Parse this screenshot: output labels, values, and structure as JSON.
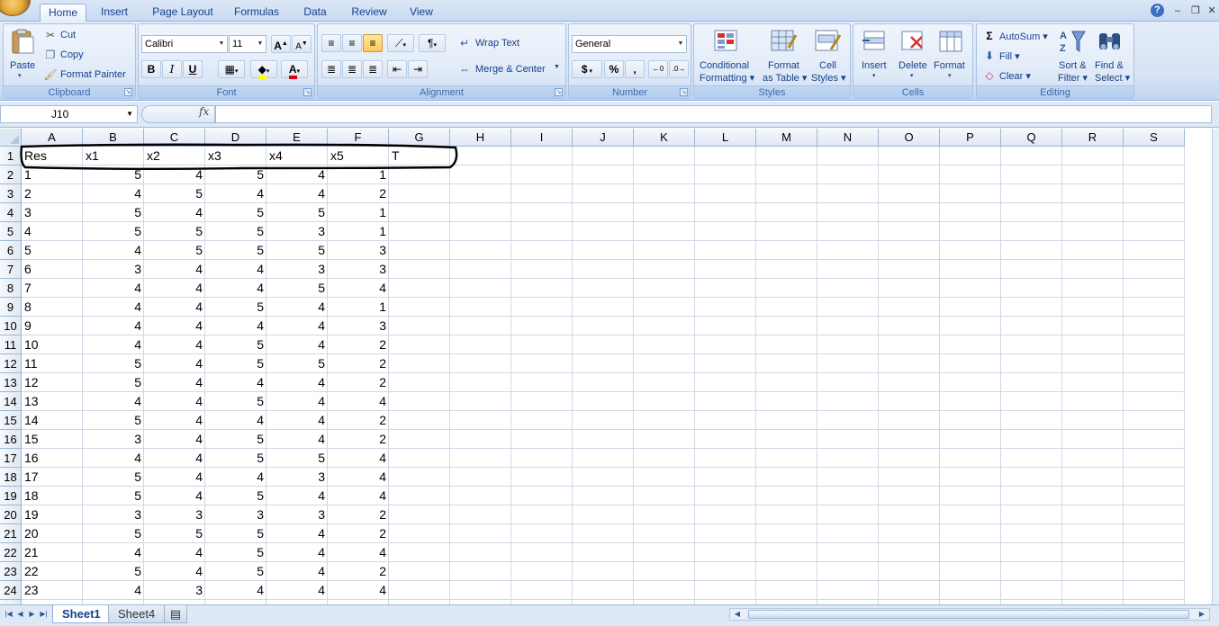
{
  "ribbon_tabs": [
    "Home",
    "Insert",
    "Page Layout",
    "Formulas",
    "Data",
    "Review",
    "View"
  ],
  "active_tab": "Home",
  "clipboard": {
    "paste": "Paste",
    "cut": "Cut",
    "copy": "Copy",
    "format_painter": "Format Painter",
    "label": "Clipboard"
  },
  "font": {
    "name": "Calibri",
    "size": "11",
    "bold": "B",
    "italic": "I",
    "underline": "U",
    "label": "Font"
  },
  "alignment": {
    "wrap_text": "Wrap Text",
    "merge_center": "Merge & Center",
    "label": "Alignment"
  },
  "number": {
    "format": "General",
    "currency": "$",
    "percent": "%",
    "comma": ",",
    "label": "Number"
  },
  "styles": {
    "conditional_1": "Conditional",
    "conditional_2": "Formatting",
    "format_table_1": "Format",
    "format_table_2": "as Table",
    "cell_styles_1": "Cell",
    "cell_styles_2": "Styles",
    "label": "Styles"
  },
  "cells": {
    "insert": "Insert",
    "delete": "Delete",
    "format": "Format",
    "label": "Cells"
  },
  "editing": {
    "autosum": "AutoSum",
    "fill": "Fill",
    "clear": "Clear",
    "sort_1": "Sort &",
    "sort_2": "Filter",
    "find_1": "Find &",
    "find_2": "Select",
    "label": "Editing"
  },
  "formula_bar": {
    "name_box": "J10",
    "fx": "fx",
    "content": ""
  },
  "columns": [
    "A",
    "B",
    "C",
    "D",
    "E",
    "F",
    "G",
    "H",
    "I",
    "J",
    "K",
    "L",
    "M",
    "N",
    "O",
    "P",
    "Q",
    "R",
    "S"
  ],
  "header_row": [
    "Res",
    "x1",
    "x2",
    "x3",
    "x4",
    "x5",
    "T"
  ],
  "rows": [
    [
      "1",
      "5",
      "4",
      "5",
      "4",
      "1"
    ],
    [
      "2",
      "4",
      "5",
      "4",
      "4",
      "2"
    ],
    [
      "3",
      "5",
      "4",
      "5",
      "5",
      "1"
    ],
    [
      "4",
      "5",
      "5",
      "5",
      "3",
      "1"
    ],
    [
      "5",
      "4",
      "5",
      "5",
      "5",
      "3"
    ],
    [
      "6",
      "3",
      "4",
      "4",
      "3",
      "3"
    ],
    [
      "7",
      "4",
      "4",
      "4",
      "5",
      "4"
    ],
    [
      "8",
      "4",
      "4",
      "5",
      "4",
      "1"
    ],
    [
      "9",
      "4",
      "4",
      "4",
      "4",
      "3"
    ],
    [
      "10",
      "4",
      "4",
      "5",
      "4",
      "2"
    ],
    [
      "11",
      "5",
      "4",
      "5",
      "5",
      "2"
    ],
    [
      "12",
      "5",
      "4",
      "4",
      "4",
      "2"
    ],
    [
      "13",
      "4",
      "4",
      "5",
      "4",
      "4"
    ],
    [
      "14",
      "5",
      "4",
      "4",
      "4",
      "2"
    ],
    [
      "15",
      "3",
      "4",
      "5",
      "4",
      "2"
    ],
    [
      "16",
      "4",
      "4",
      "5",
      "5",
      "4"
    ],
    [
      "17",
      "5",
      "4",
      "4",
      "3",
      "4"
    ],
    [
      "18",
      "5",
      "4",
      "5",
      "4",
      "4"
    ],
    [
      "19",
      "3",
      "3",
      "3",
      "3",
      "2"
    ],
    [
      "20",
      "5",
      "5",
      "5",
      "4",
      "2"
    ],
    [
      "21",
      "4",
      "4",
      "5",
      "4",
      "4"
    ],
    [
      "22",
      "5",
      "4",
      "5",
      "4",
      "2"
    ],
    [
      "23",
      "4",
      "3",
      "4",
      "4",
      "4"
    ]
  ],
  "sheet_tabs": [
    "Sheet1",
    "Sheet4"
  ],
  "active_sheet": "Sheet1",
  "colors": {
    "ribbon": "#d6e3f5",
    "grid_line": "#d0d7e5",
    "header": "#dfe8f5",
    "text_blue": "#15428b"
  }
}
